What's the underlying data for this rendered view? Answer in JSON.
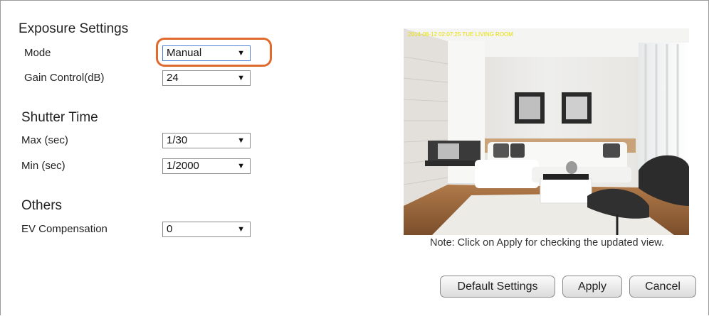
{
  "exposure": {
    "title": "Exposure Settings",
    "mode_label": "Mode",
    "mode_value": "Manual",
    "gain_label": "Gain Control(dB)",
    "gain_value": "24"
  },
  "shutter": {
    "title": "Shutter Time",
    "max_label": "Max (sec)",
    "max_value": "1/30",
    "min_label": "Min (sec)",
    "min_value": "1/2000"
  },
  "others": {
    "title": "Others",
    "ev_label": "EV Compensation",
    "ev_value": "0"
  },
  "preview": {
    "overlay_text": "2014-08-12 02:07:25 TUE  LIVING ROOM",
    "note": "Note: Click on Apply for checking the updated view."
  },
  "buttons": {
    "default": "Default Settings",
    "apply": "Apply",
    "cancel": "Cancel"
  },
  "colors": {
    "highlight": "#e06a2d",
    "overlay_text": "#e8e000"
  },
  "icons": {
    "dropdown": "dropdown-arrow-icon"
  }
}
